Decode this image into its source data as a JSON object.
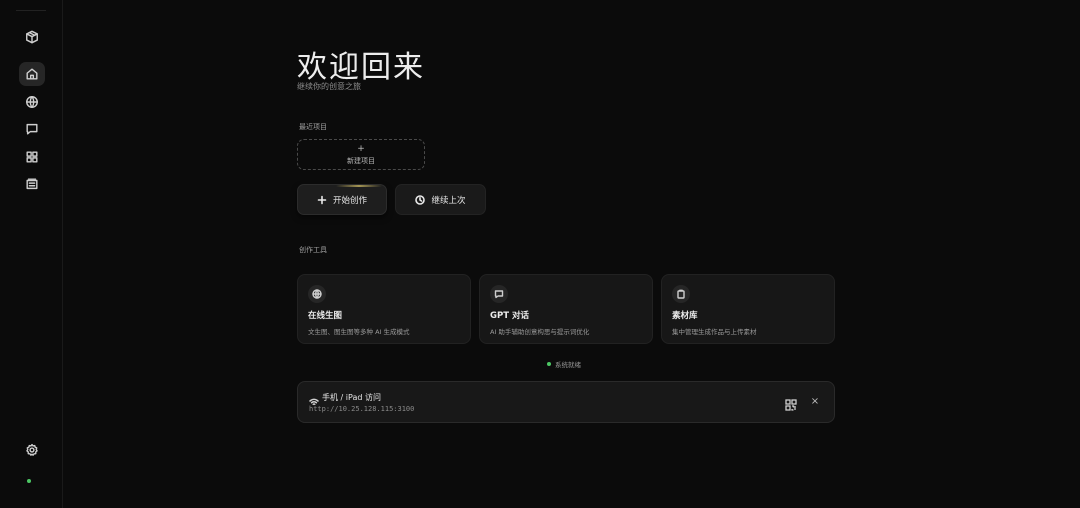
{
  "sidebar": {
    "items": [
      {
        "name": "logo",
        "icon": "cube-logo-icon"
      },
      {
        "name": "home",
        "icon": "home-icon",
        "active": true
      },
      {
        "name": "globe",
        "icon": "globe-icon"
      },
      {
        "name": "chat",
        "icon": "chat-icon"
      },
      {
        "name": "grid",
        "icon": "grid-icon"
      },
      {
        "name": "library",
        "icon": "library-icon"
      }
    ],
    "settings_icon": "gear-icon",
    "status_color": "#4cc764"
  },
  "hero": {
    "title": "欢迎回来",
    "subtitle": "继续你的创意之旅"
  },
  "recent": {
    "label": "最近项目",
    "new_project_plus": "+",
    "new_project_label": "新建项目"
  },
  "actions": {
    "start_icon": "+",
    "start_label": "开始创作",
    "continue_label": "继续上次"
  },
  "tools": {
    "label": "创作工具",
    "cards": [
      {
        "icon": "globe-icon",
        "title": "在线生图",
        "desc": "文生图、图生图等多种 AI 生成模式"
      },
      {
        "icon": "chat-icon",
        "title": "GPT 对话",
        "desc": "AI 助手辅助创意构思与提示词优化"
      },
      {
        "icon": "clipboard-icon",
        "title": "素材库",
        "desc": "集中管理生成作品与上传素材"
      }
    ]
  },
  "status": {
    "text": "系统就绪",
    "color": "#4cc764"
  },
  "mobile": {
    "title": "手机 / iPad 访问",
    "url": "http://10.25.128.115:3100",
    "close": "×"
  }
}
